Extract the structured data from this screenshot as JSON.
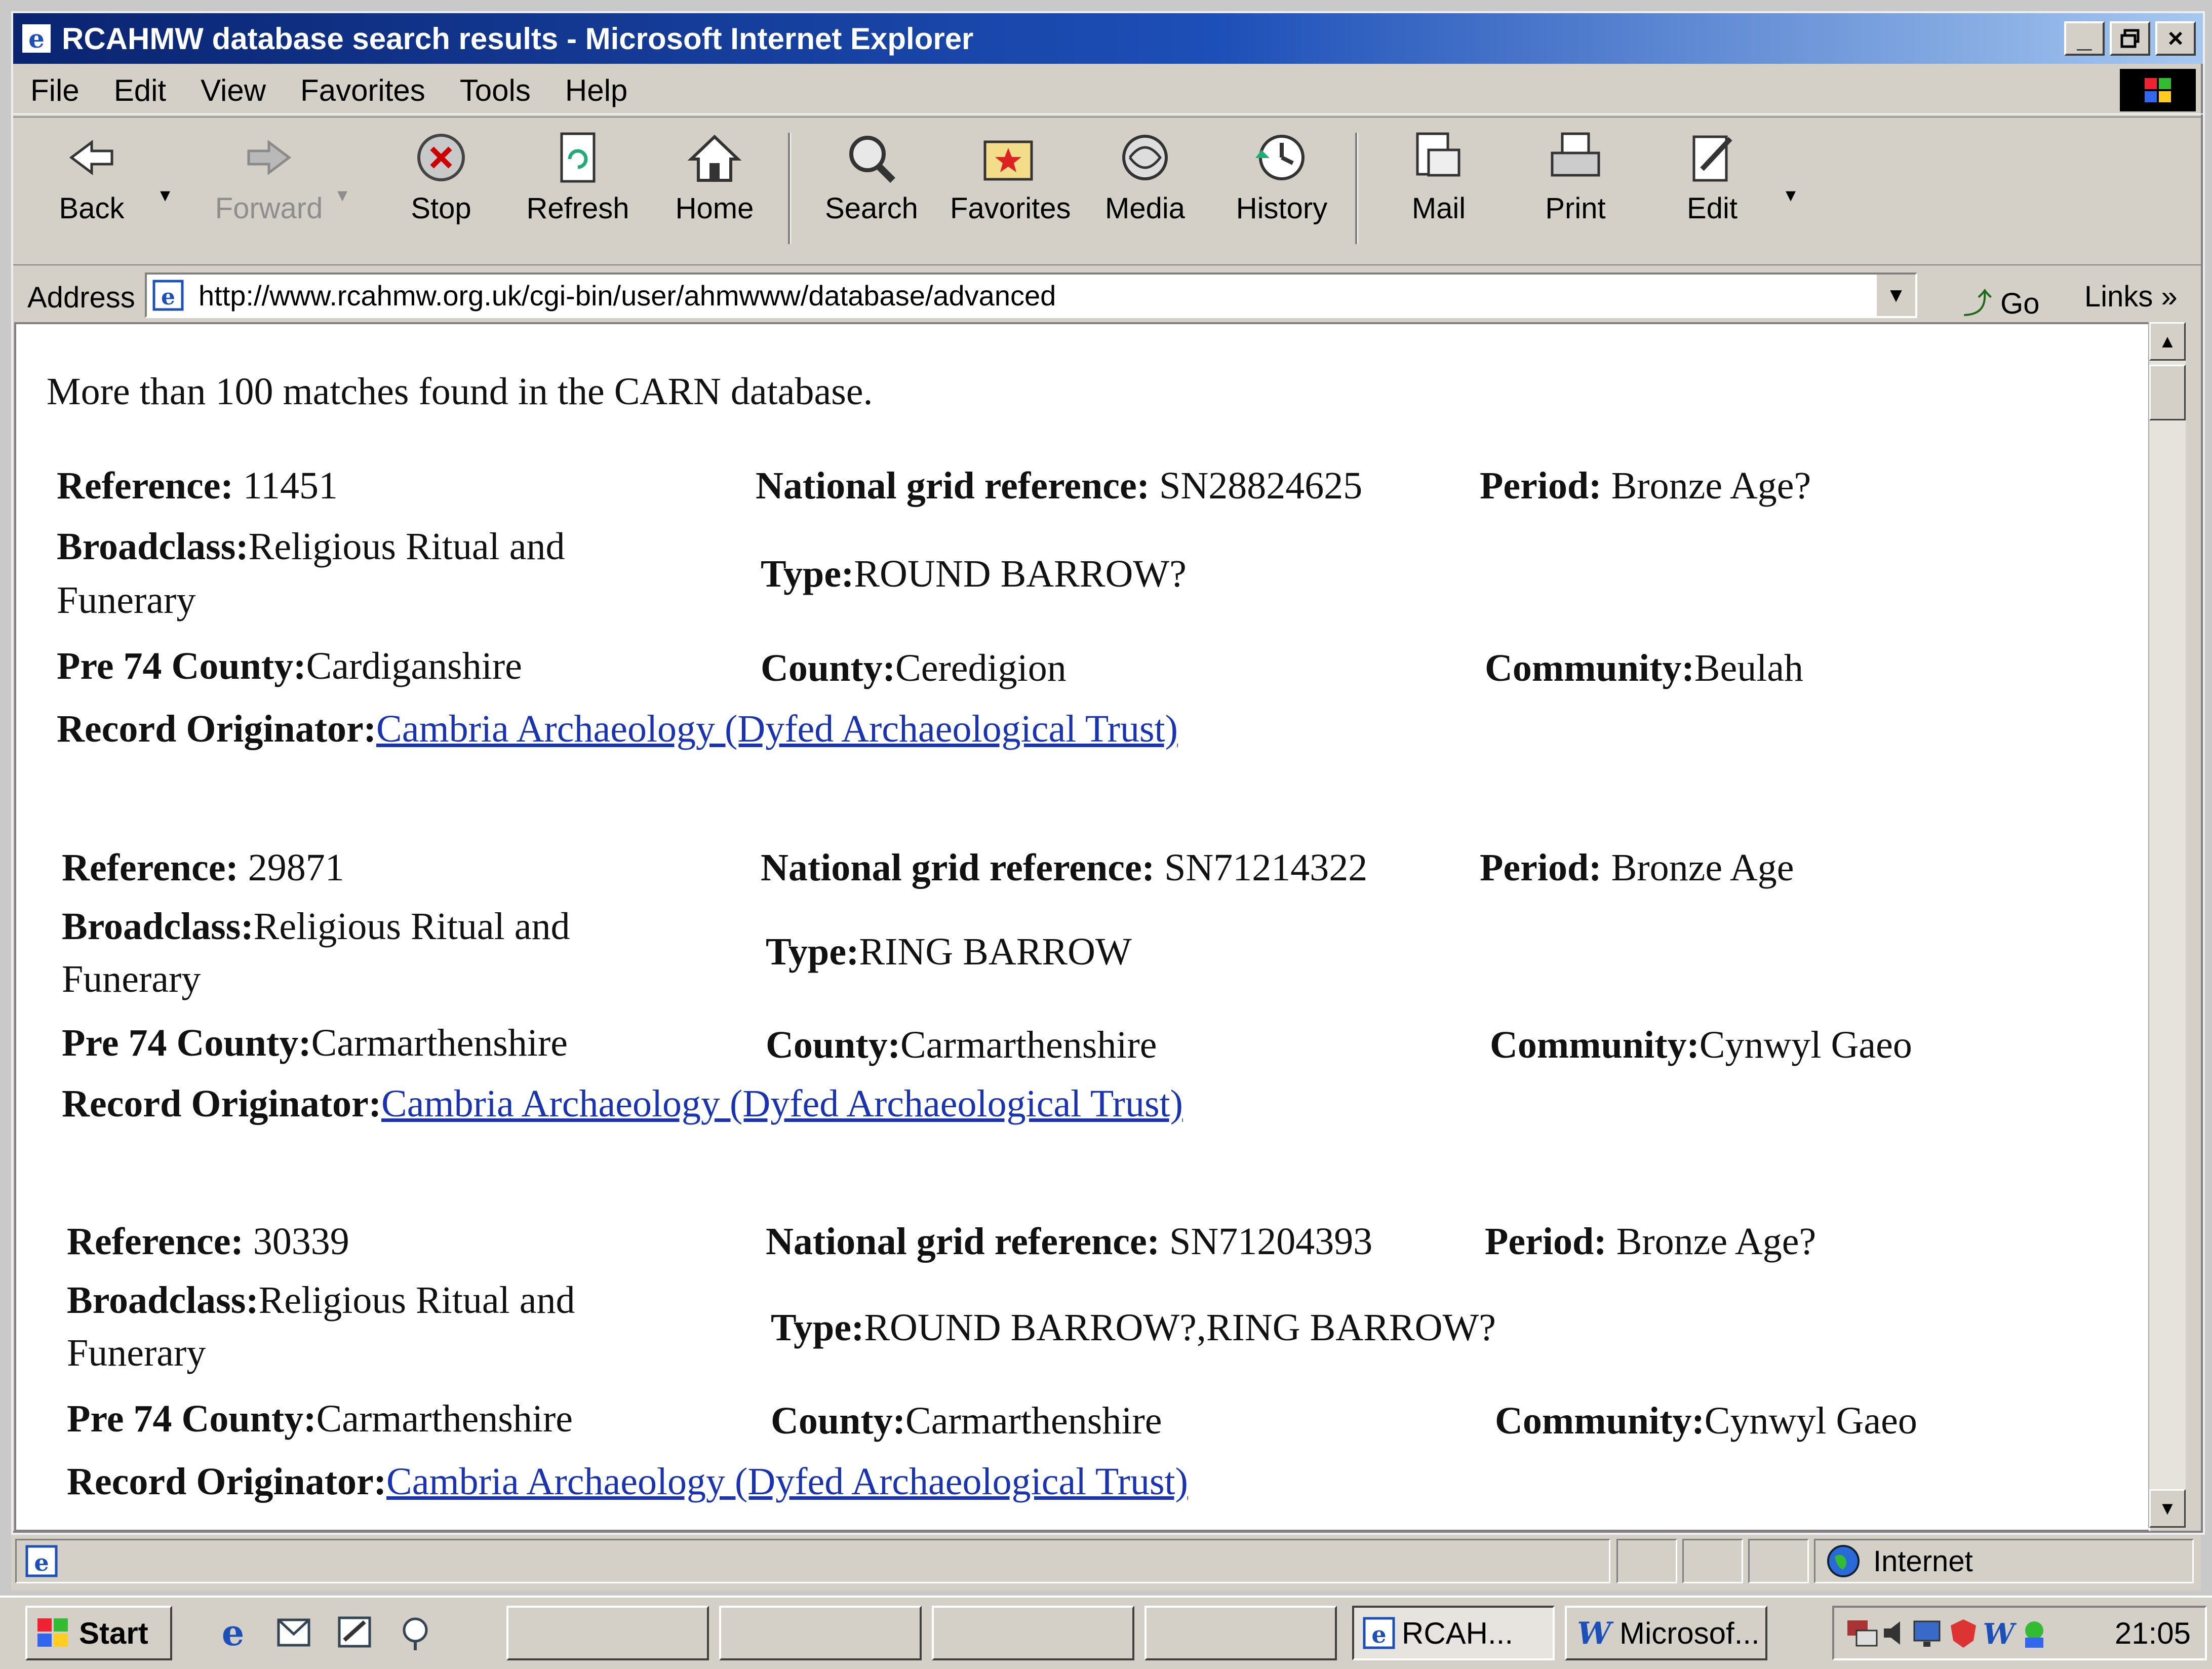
{
  "window": {
    "title": "RCAHMW database search results - Microsoft Internet Explorer",
    "controls": [
      "_",
      "ř",
      "×"
    ]
  },
  "menu": [
    "File",
    "Edit",
    "View",
    "Favorites",
    "Tools",
    "Help"
  ],
  "toolbar": [
    {
      "label": "Back",
      "icon": "back-arrow-icon"
    },
    {
      "label": "Forward",
      "icon": "forward-arrow-icon"
    },
    {
      "label": "Stop",
      "icon": "stop-icon"
    },
    {
      "label": "Refresh",
      "icon": "refresh-icon"
    },
    {
      "label": "Home",
      "icon": "home-icon"
    },
    {
      "label": "Search",
      "icon": "search-icon"
    },
    {
      "label": "Favorites",
      "icon": "favorites-icon"
    },
    {
      "label": "Media",
      "icon": "media-icon"
    },
    {
      "label": "History",
      "icon": "history-icon"
    },
    {
      "label": "Mail",
      "icon": "mail-icon"
    },
    {
      "label": "Print",
      "icon": "print-icon"
    },
    {
      "label": "Edit",
      "icon": "edit-icon"
    }
  ],
  "address": {
    "label": "Address",
    "url": "http://www.rcahmw.org.uk/cgi-bin/user/ahmwww/database/advanced",
    "go": "Go",
    "links": "Links"
  },
  "content": {
    "summary": "More than 100 matches found in the CARN database.",
    "labels": {
      "reference": "Reference:",
      "ngr": "National grid reference:",
      "period": "Period:",
      "broadclass": "Broadclass:",
      "type": "Type:",
      "pre74": "Pre 74 County:",
      "county": "County:",
      "community": "Community:",
      "originator": "Record Originator:"
    },
    "records": [
      {
        "reference": "11451",
        "ngr": "SN28824625",
        "period": "Bronze Age?",
        "broadclass_line1": "Religious Ritual and",
        "broadclass_line2": "Funerary",
        "type": "ROUND BARROW?",
        "pre74": "Cardiganshire",
        "county": "Ceredigion",
        "community": "Beulah",
        "originator": "Cambria Archaeology (Dyfed Archaeological Trust)"
      },
      {
        "reference": "29871",
        "ngr": "SN71214322",
        "period": "Bronze Age",
        "broadclass_line1": "Religious Ritual and",
        "broadclass_line2": "Funerary",
        "type": "RING BARROW",
        "pre74": "Carmarthenshire",
        "county": "Carmarthenshire",
        "community": "Cynwyl Gaeo",
        "originator": "Cambria Archaeology (Dyfed Archaeological Trust)"
      },
      {
        "reference": "30339",
        "ngr": "SN71204393",
        "period": "Bronze Age?",
        "broadclass_line1": "Religious Ritual and",
        "broadclass_line2": "Funerary",
        "type": "ROUND BARROW?,RING BARROW?",
        "pre74": "Carmarthenshire",
        "county": "Carmarthenshire",
        "community": "Cynwyl Gaeo",
        "originator": "Cambria Archaeology (Dyfed Archaeological Trust)"
      }
    ]
  },
  "status": {
    "zone": "Internet"
  },
  "taskbar": {
    "start": "Start",
    "tasks": [
      "RCAH...",
      "Microsof..."
    ],
    "clock": "21:05"
  },
  "colors": {
    "title_gradient_start": "#0a2470",
    "title_gradient_end": "#a6c8f0",
    "link": "#1a33b0",
    "chrome": "#d4d0c8"
  }
}
